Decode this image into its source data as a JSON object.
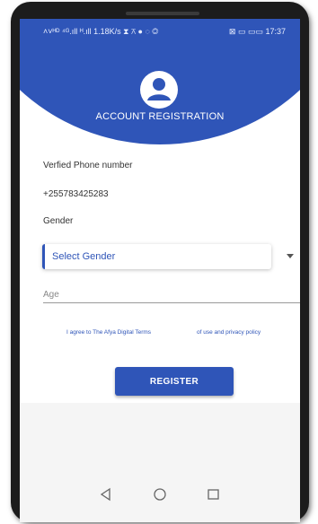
{
  "status_bar": {
    "left": "˄˅ᴴᴰ ⁴ᴳ.ıll ᴴ.ıll 1.18K/s ⧗ ⊼ ● ◌ ◎",
    "right": "⊠ ▭ ▭▭ 17:37"
  },
  "header": {
    "title": "ACCOUNT REGISTRATION"
  },
  "form": {
    "phone_label": "Verfied Phone number",
    "phone_value": "+255783425283",
    "gender_label": "Gender",
    "gender_select": "Select Gender",
    "age_placeholder": "Age",
    "terms_part1": "I agree to The Afya Digital Terms",
    "terms_part2": "of use and privacy policy",
    "register_label": "REGISTER"
  },
  "colors": {
    "primary": "#2f55b8",
    "background": "#ffffff",
    "footer": "#f5f5f5"
  },
  "icons": {
    "avatar": "user-avatar-icon",
    "dropdown": "triangle-down-icon",
    "nav_back": "triangle-left-icon",
    "nav_home": "circle-icon",
    "nav_recents": "square-icon"
  }
}
